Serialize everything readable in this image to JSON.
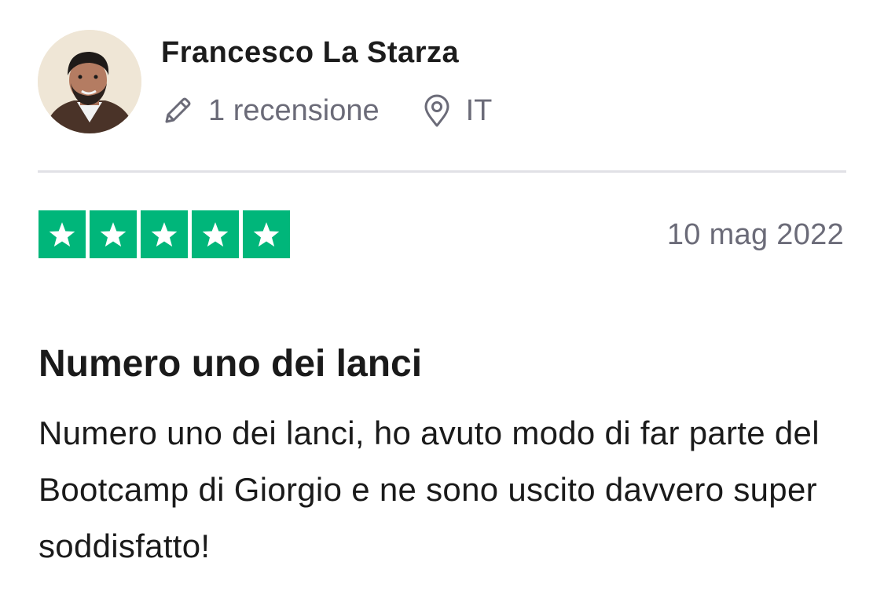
{
  "review": {
    "consumer": {
      "name": "Francesco La Starza",
      "review_count_label": "1 recensione",
      "country": "IT",
      "avatar_icon": "person-photo",
      "meta_icons": [
        "pencil-icon",
        "location-pin-icon"
      ]
    },
    "rating": {
      "stars": 5,
      "max_stars": 5,
      "star_color": "#00b67a"
    },
    "date": "10 mag 2022",
    "title": "Numero uno dei lanci",
    "text": "Numero uno dei lanci, ho avuto modo di far parte del Bootcamp di Giorgio e ne sono uscito davvero super soddisfatto!"
  },
  "colors": {
    "text_primary": "#1a1a1a",
    "text_secondary": "#6b6b78",
    "divider": "#e1e1e6",
    "trustpilot_green": "#00b67a"
  }
}
